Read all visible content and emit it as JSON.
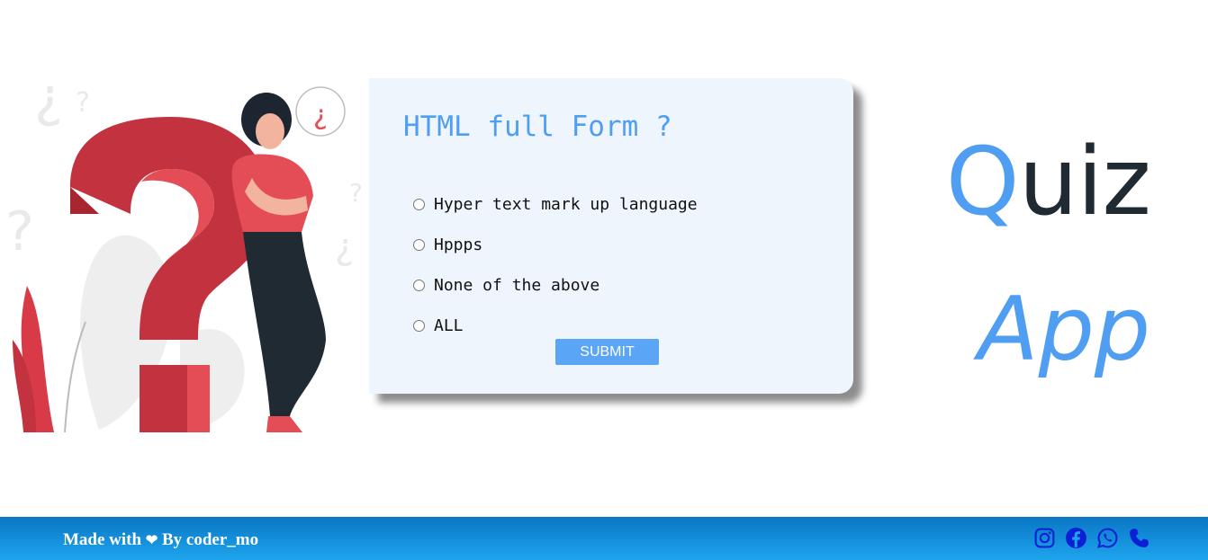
{
  "quiz": {
    "question": "HTML full Form ?",
    "options": [
      {
        "label": "Hyper text mark up language",
        "selected": false
      },
      {
        "label": "Hppps",
        "selected": false
      },
      {
        "label": "None of the above",
        "selected": false
      },
      {
        "label": "ALL",
        "selected": false
      }
    ],
    "submit_label": "SUBMIT"
  },
  "title": {
    "first_letter": "Q",
    "rest": "uiz",
    "line2": "App"
  },
  "footer": {
    "made_with": "Made with",
    "heart": "❤",
    "by": "By coder_mo",
    "social_icons": [
      "instagram-icon",
      "facebook-icon",
      "whatsapp-icon",
      "phone-icon"
    ]
  },
  "colors": {
    "accent": "#4f9ef1",
    "title_dark": "#1f2a33",
    "footer_top": "#0a77c4",
    "footer_bottom": "#1ea4ee",
    "illustration_red": "#c2323f",
    "social_icon": "#0b1fd6"
  }
}
